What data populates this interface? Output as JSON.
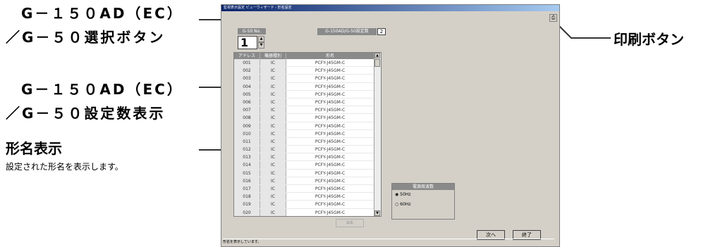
{
  "callouts": {
    "g150_select_line1": "G－１５０AD（EC）",
    "g150_select_line2": "／G－５０選択ボタン",
    "g150_count_line1": "G－１５０AD（EC）",
    "g150_count_line2": "／G－５０設定数表示",
    "model_display_title": "形名表示",
    "model_display_desc": "設定された形名を表示します。",
    "print_button": "印刷ボタン"
  },
  "window": {
    "title": "監視表示設定 ビューウィザード - 形名設定",
    "status": "形名を表示しています。"
  },
  "g50": {
    "label": "G-50 No.",
    "value": "1"
  },
  "setting_count": {
    "label": "G-150AD/G-50設定数",
    "value": "2"
  },
  "table": {
    "headers": [
      "アドレス",
      "機器種別",
      "形名"
    ],
    "rows": [
      [
        "001",
        "IC",
        "PCFY-J45GM-C"
      ],
      [
        "002",
        "IC",
        "PCFY-J45GM-C"
      ],
      [
        "003",
        "IC",
        "PCFY-J45GM-C"
      ],
      [
        "004",
        "IC",
        "PCFY-J45GM-C"
      ],
      [
        "005",
        "IC",
        "PCFY-J45GM-C"
      ],
      [
        "006",
        "IC",
        "PCFY-J45GM-C"
      ],
      [
        "007",
        "IC",
        "PCFY-J45GM-C"
      ],
      [
        "008",
        "IC",
        "PCFY-J45GM-C"
      ],
      [
        "009",
        "IC",
        "PCFY-J45GM-C"
      ],
      [
        "010",
        "IC",
        "PCFY-J45GM-C"
      ],
      [
        "011",
        "IC",
        "PCFY-J45GM-C"
      ],
      [
        "012",
        "IC",
        "PCFY-J45GM-C"
      ],
      [
        "013",
        "IC",
        "PCFY-J45GM-C"
      ],
      [
        "014",
        "IC",
        "PCFY-J45GM-C"
      ],
      [
        "015",
        "IC",
        "PCFY-J45GM-C"
      ],
      [
        "016",
        "IC",
        "PCFY-J45GM-C"
      ],
      [
        "017",
        "IC",
        "PCFY-J45GM-C"
      ],
      [
        "018",
        "IC",
        "PCFY-J45GM-C"
      ],
      [
        "019",
        "IC",
        "PCFY-J45GM-C"
      ],
      [
        "020",
        "IC",
        "PCFY-J45GM-C"
      ]
    ]
  },
  "edit_button": "編集",
  "frequency": {
    "label": "電源周波数",
    "options": [
      "50Hz",
      "60Hz"
    ],
    "selected": "50Hz"
  },
  "buttons": {
    "next": "次へ",
    "finish": "終了"
  },
  "icons": {
    "print": "printer-icon",
    "spin_up": "chevron-up-icon",
    "spin_down": "chevron-down-icon"
  }
}
